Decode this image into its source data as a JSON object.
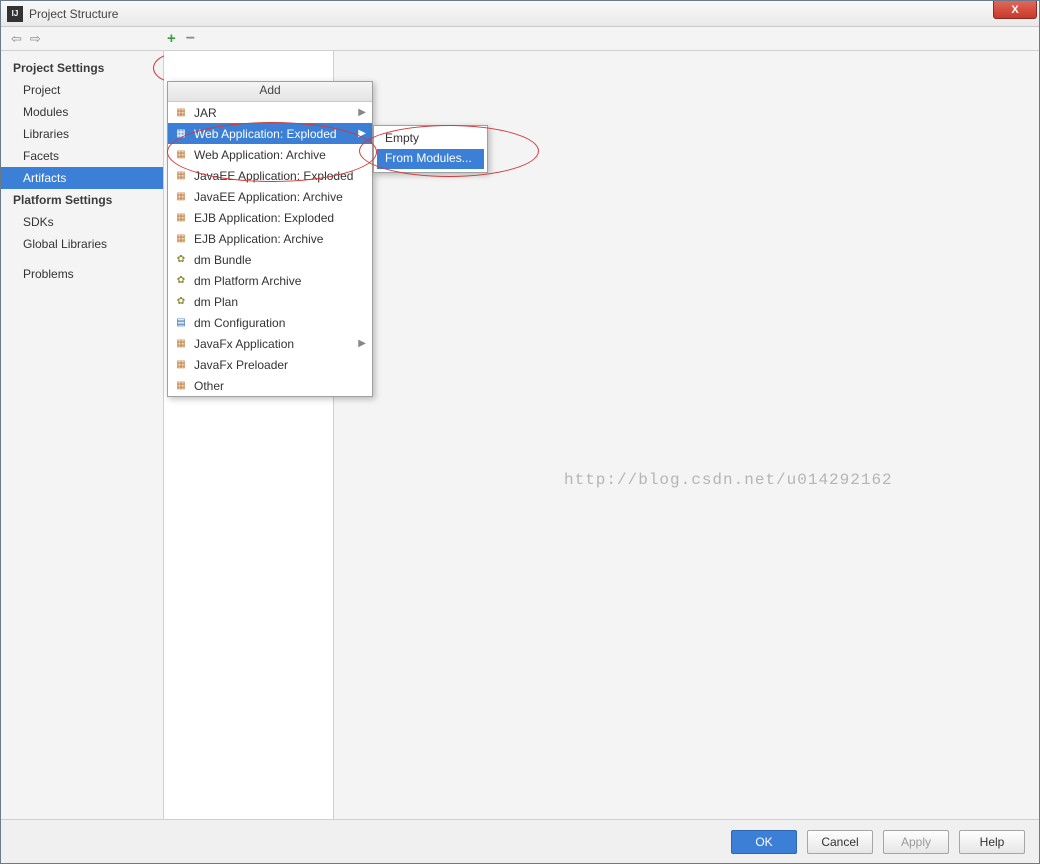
{
  "window": {
    "title": "Project Structure",
    "close_label": "X"
  },
  "toolbar": {
    "plus": "+",
    "minus": "−"
  },
  "sidebar": {
    "section1_title": "Project Settings",
    "items1": [
      {
        "label": "Project"
      },
      {
        "label": "Modules"
      },
      {
        "label": "Libraries"
      },
      {
        "label": "Facets"
      },
      {
        "label": "Artifacts",
        "selected": true
      }
    ],
    "section2_title": "Platform Settings",
    "items2": [
      {
        "label": "SDKs"
      },
      {
        "label": "Global Libraries"
      }
    ],
    "problems_label": "Problems"
  },
  "add_menu": {
    "header": "Add",
    "items": [
      {
        "label": "JAR",
        "icon": "gift",
        "submenu": true
      },
      {
        "label": "Web Application: Exploded",
        "icon": "gift",
        "submenu": true,
        "highlight": true
      },
      {
        "label": "Web Application: Archive",
        "icon": "gift"
      },
      {
        "label": "JavaEE Application: Exploded",
        "icon": "gift"
      },
      {
        "label": "JavaEE Application: Archive",
        "icon": "gift"
      },
      {
        "label": "EJB Application: Exploded",
        "icon": "gift"
      },
      {
        "label": "EJB Application: Archive",
        "icon": "gift"
      },
      {
        "label": "dm Bundle",
        "icon": "cog"
      },
      {
        "label": "dm Platform Archive",
        "icon": "cog"
      },
      {
        "label": "dm Plan",
        "icon": "cog"
      },
      {
        "label": "dm Configuration",
        "icon": "doc"
      },
      {
        "label": "JavaFx Application",
        "icon": "gift",
        "submenu": true
      },
      {
        "label": "JavaFx Preloader",
        "icon": "gift"
      },
      {
        "label": "Other",
        "icon": "gift"
      }
    ]
  },
  "sub_menu": {
    "items": [
      {
        "label": "Empty"
      },
      {
        "label": "From Modules...",
        "highlight": true
      }
    ]
  },
  "watermark": "http://blog.csdn.net/u014292162",
  "footer": {
    "ok": "OK",
    "cancel": "Cancel",
    "apply": "Apply",
    "help": "Help"
  }
}
